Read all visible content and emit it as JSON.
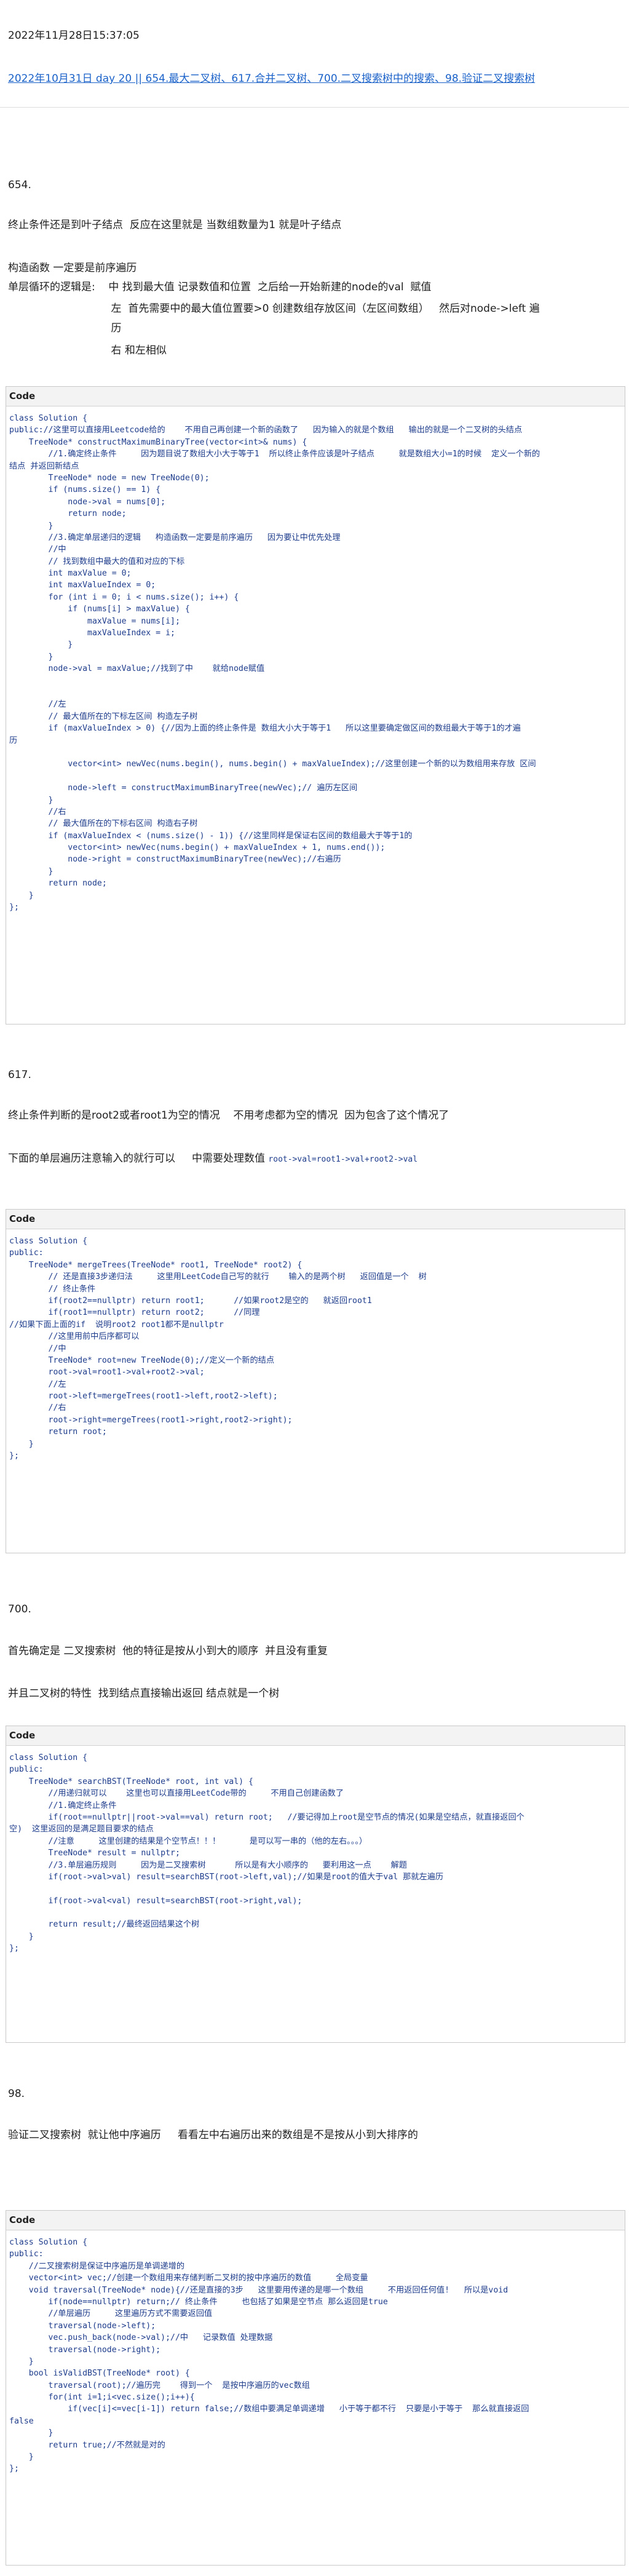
{
  "header": {
    "timestamp": "2022年11月28日15:37:05",
    "link_text": "2022年10月31日 day 20 || 654.最大二叉树、617.合并二叉树、700.二叉搜索树中的搜索、98.验证二叉搜索树"
  },
  "sections": [
    {
      "id": "654",
      "number": "654.",
      "paragraphs": [
        "终止条件还是到叶子结点  反应在这里就是 当数组数量为1 就是叶子结点",
        "构造函数 一定要是前序遍历",
        "单层循环的逻辑是:    中 找到最大值 记录数值和位置  之后给一开始新建的node的val  赋值",
        "                               左  首先需要中的最大值位置要>0 创建数组存放区间（左区间数组）   然后对node->left 遍",
        "                               历",
        "                               右 和左相似"
      ],
      "code_header": "Code",
      "code": [
        "class Solution {",
        "public://这里可以直接用Leetcode给的    不用自己再创建一个新的函数了   因为输入的就是个数组   输出的就是一个二叉树的头结点",
        "    TreeNode* constructMaximumBinaryTree(vector<int>& nums) {",
        "        //1.确定终止条件     因为题目说了数组大小大于等于1  所以终止条件应该是叶子结点     就是数组大小=1的时候  定义一个新的",
        "结点 并返回新结点",
        "        TreeNode* node = new TreeNode(0);",
        "        if (nums.size() == 1) {",
        "            node->val = nums[0];",
        "            return node;",
        "        }",
        "        //3.确定单层递归的逻辑   构造函数一定要是前序遍历   因为要让中优先处理",
        "        //中",
        "        // 找到数组中最大的值和对应的下标",
        "        int maxValue = 0;",
        "        int maxValueIndex = 0;",
        "        for (int i = 0; i < nums.size(); i++) {",
        "            if (nums[i] > maxValue) {",
        "                maxValue = nums[i];",
        "                maxValueIndex = i;",
        "            }",
        "        }",
        "        node->val = maxValue;//找到了中    就给node赋值",
        "",
        "",
        "        //左",
        "        // 最大值所在的下标左区间 构造左子树",
        "        if (maxValueIndex > 0) {//因为上面的终止条件是 数组大小大于等于1   所以这里要确定做区间的数组最大于等于1的才遍",
        "历",
        "",
        "            vector<int> newVec(nums.begin(), nums.begin() + maxValueIndex);//这里创建一个新的以为数组用来存放 区间",
        "",
        "            node->left = constructMaximumBinaryTree(newVec);// 遍历左区间",
        "        }",
        "        //右",
        "        // 最大值所在的下标右区间 构造右子树",
        "        if (maxValueIndex < (nums.size() - 1)) {//这里同样是保证右区间的数组最大于等于1的",
        "            vector<int> newVec(nums.begin() + maxValueIndex + 1, nums.end());",
        "            node->right = constructMaximumBinaryTree(newVec);//右遍历",
        "        }",
        "        return node;",
        "    }",
        "};"
      ]
    },
    {
      "id": "617",
      "number": "617.",
      "paragraphs": [
        "终止条件判断的是root2或者root1为空的情况    不用考虑都为空的情况  因为包含了这个情况了",
        "下面的单层遍历注意输入的就行可以     中需要处理数值 "
      ],
      "inline_code": "root->val=root1->val+root2->val",
      "code_header": "Code",
      "code": [
        "class Solution {",
        "public:",
        "    TreeNode* mergeTrees(TreeNode* root1, TreeNode* root2) {",
        "        // 还是直接3步递归法     这里用LeetCode自己写的就行    输入的是两个树   返回值是一个  树",
        "        // 终止条件",
        "        if(root2==nullptr) return root1;      //如果root2是空的   就返回root1",
        "        if(root1==nullptr) return root2;      //同理",
        "//如果下面上面的if  说明root2 root1都不是nullptr",
        "        //这里用前中后序都可以",
        "        //中",
        "        TreeNode* root=new TreeNode(0);//定义一个新的结点",
        "        root->val=root1->val+root2->val;",
        "        //左",
        "        root->left=mergeTrees(root1->left,root2->left);",
        "        //右",
        "        root->right=mergeTrees(root1->right,root2->right);",
        "        return root;",
        "    }",
        "};"
      ]
    },
    {
      "id": "700",
      "number": "700.",
      "paragraphs": [
        "首先确定是 二叉搜索树  他的特征是按从小到大的顺序  并且没有重复",
        "并且二叉树的特性  找到结点直接输出返回 结点就是一个树"
      ],
      "code_header": "Code",
      "code": [
        "class Solution {",
        "public:",
        "    TreeNode* searchBST(TreeNode* root, int val) {",
        "        //用递归就可以    这里也可以直接用LeetCode带的     不用自己创建函数了",
        "        //1.确定终止条件",
        "        if(root==nullptr||root->val==val) return root;   //要记得加上root是空节点的情况(如果是空结点，就直接返回个",
        "空)  这里返回的是满足题目要求的结点",
        "        //注意     这里创建的结果是个空节点！！！      是可以写一串的（他的左右。。。）",
        "        TreeNode* result = nullptr;",
        "        //3.单层遍历规则     因为是二叉搜索树      所以是有大小顺序的   要利用这一点    解题",
        "        if(root->val>val) result=searchBST(root->left,val);//如果是root的值大于val 那就左遍历",
        "",
        "        if(root->val<val) result=searchBST(root->right,val);",
        "",
        "        return result;//最终返回结果这个树",
        "    }",
        "};"
      ]
    },
    {
      "id": "98",
      "number": "98.",
      "paragraphs": [
        "验证二叉搜索树  就让他中序遍历     看看左中右遍历出来的数组是不是按从小到大排序的"
      ],
      "code_header": "Code",
      "code": [
        "class Solution {",
        "public:",
        "    //二叉搜索树是保证中序遍历是单调递增的",
        "    vector<int> vec;//创建一个数组用来存储判断二叉树的按中序遍历的数值     全局变量",
        "    void traversal(TreeNode* node){//还是直接的3步   这里要用传递的是哪一个数组     不用返回任何值!   所以是void",
        "        if(node==nullptr) return;// 终止条件     也包括了如果是空节点 那么返回是true",
        "        //单层遍历     这里遍历方式不需要返回值",
        "        traversal(node->left);",
        "        vec.push_back(node->val);//中   记录数值 处理数据",
        "        traversal(node->right);",
        "    }",
        "    bool isValidBST(TreeNode* root) {",
        "        traversal(root);//遍历完    得到一个  是按中序遍历的vec数组",
        "        for(int i=1;i<vec.size();i++){",
        "            if(vec[i]<=vec[i-1]) return false;//数组中要满足单调递增   小于等于都不行  只要是小于等于  那么就直接返回",
        "false",
        "        }",
        "        return true;//不然就是对的",
        "    }",
        "};"
      ]
    }
  ]
}
